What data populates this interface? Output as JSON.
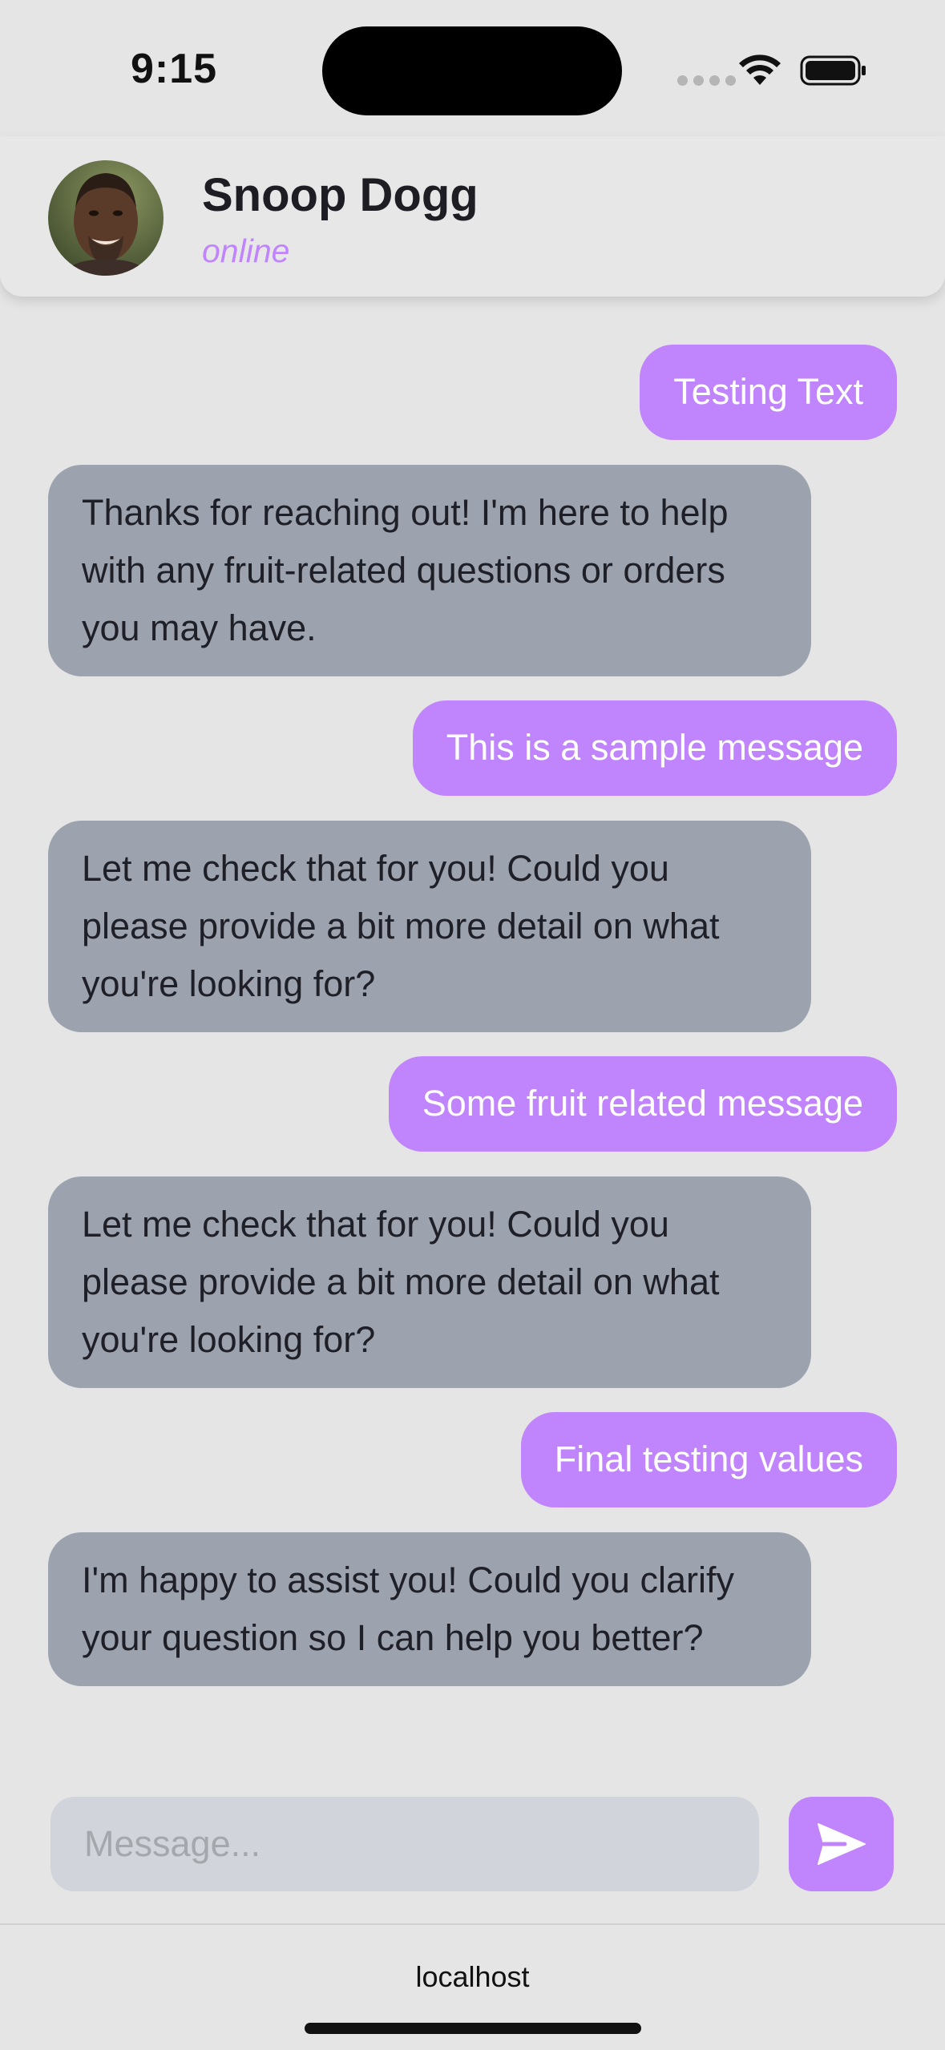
{
  "status_bar": {
    "time": "9:15",
    "icons": [
      "cellular-signal-icon",
      "wifi-icon",
      "battery-icon"
    ]
  },
  "header": {
    "contact_name": "Snoop Dogg",
    "status": "online",
    "avatar": "contact-avatar-photo"
  },
  "messages": [
    {
      "from": "user",
      "text": "Testing Text"
    },
    {
      "from": "assistant",
      "text": "Thanks for reaching out! I'm here to help with any fruit-related questions or orders you may have."
    },
    {
      "from": "user",
      "text": "This is a sample message"
    },
    {
      "from": "assistant",
      "text": "Let me check that for you! Could you please provide a bit more detail on what you're looking for?"
    },
    {
      "from": "user",
      "text": "Some fruit related message"
    },
    {
      "from": "assistant",
      "text": "Let me check that for you! Could you please provide a bit more detail on what you're looking for?"
    },
    {
      "from": "user",
      "text": "Final testing values"
    },
    {
      "from": "assistant",
      "text": "I'm happy to assist you! Could you clarify your question so I can help you better?"
    }
  ],
  "composer": {
    "placeholder": "Message...",
    "value": "",
    "send_icon": "send-icon"
  },
  "browser": {
    "url": "localhost"
  },
  "colors": {
    "accent": "#c084fc",
    "received_bubble": "#9ca3af",
    "input_bg": "#d1d5db",
    "background": "#e5e5e5"
  }
}
